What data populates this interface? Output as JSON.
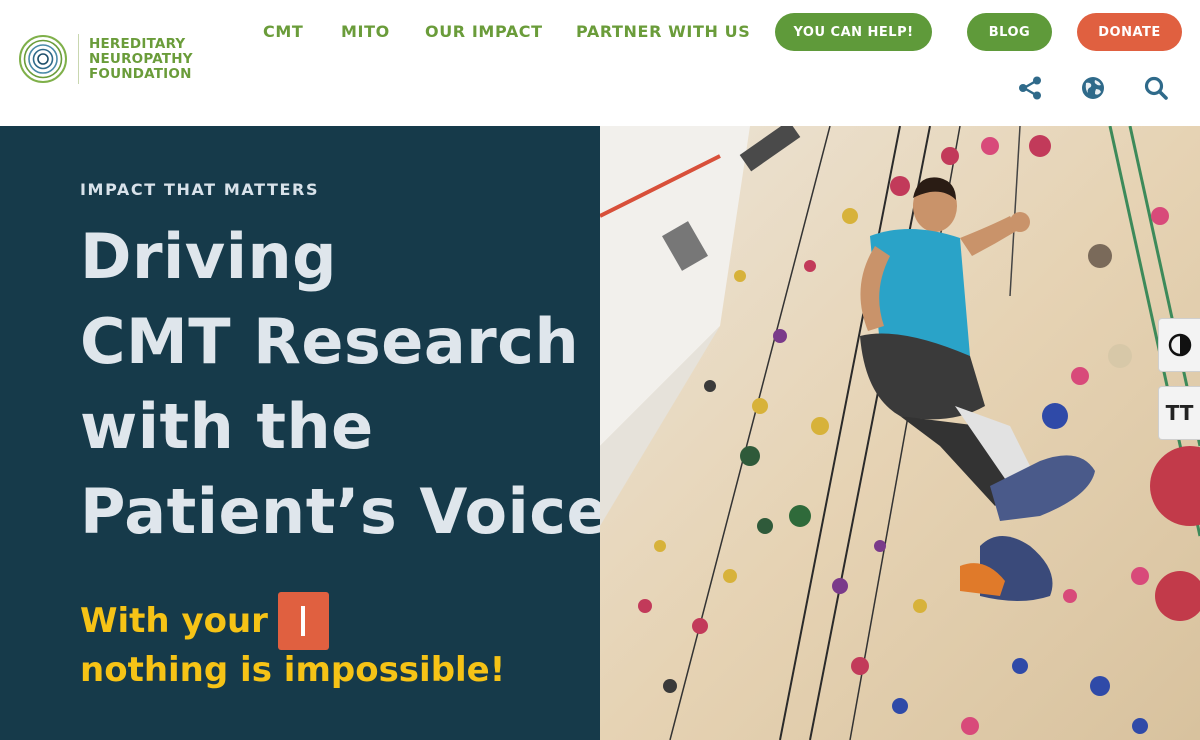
{
  "header": {
    "logo": {
      "lines": [
        "HEREDITARY",
        "NEUROPATHY",
        "FOUNDATION"
      ],
      "icon": "concentric-rings-icon"
    },
    "nav": [
      {
        "label": "CMT"
      },
      {
        "label": "MITO"
      },
      {
        "label": "OUR IMPACT"
      },
      {
        "label": "PARTNER WITH US"
      }
    ],
    "buttons": {
      "help": "YOU CAN HELP!",
      "blog": "BLOG",
      "donate": "DONATE"
    },
    "tools": [
      "share-icon",
      "globe-icon",
      "search-icon"
    ]
  },
  "hero": {
    "eyebrow": "IMPACT THAT MATTERS",
    "headline": [
      "Driving",
      "CMT Research",
      "with the",
      "Patient’s Voice"
    ],
    "tagline_start": "With your",
    "tagline_end": "nothing is impossible!",
    "image": "rock-climbing-wall-photo"
  },
  "accessibility": {
    "contrast_icon": "contrast-icon",
    "text_size_label": "TT"
  },
  "colors": {
    "brand_green": "#6a9c3a",
    "button_green": "#5f9a3a",
    "donate_orange": "#e06040",
    "hero_navy": "#163a4a",
    "tagline_yellow": "#f6c316"
  }
}
